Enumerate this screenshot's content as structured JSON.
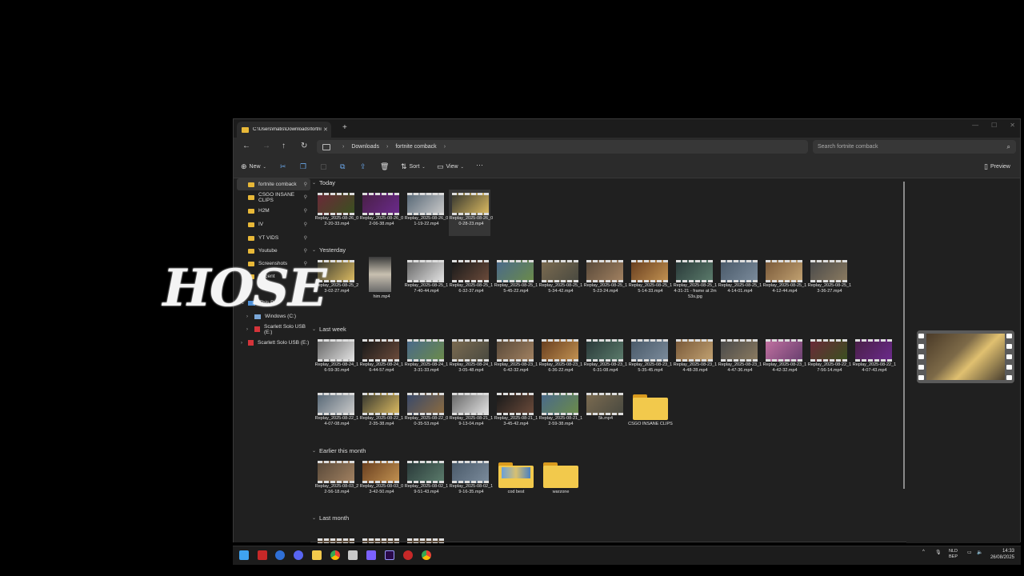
{
  "logo": {
    "text": "HOSE"
  },
  "tab": {
    "title": "C:\\Users\\matis\\Downloads\\fortnite comback",
    "close": "✕",
    "new": "+"
  },
  "window_controls": [
    "—",
    "☐",
    "✕"
  ],
  "breadcrumb": [
    "Downloads",
    "fortnite comback"
  ],
  "search": {
    "placeholder": "Search fortnite comback"
  },
  "commands": {
    "new": "New",
    "sort": "Sort",
    "view": "View",
    "more": "···",
    "preview": "Preview"
  },
  "sidebar": {
    "quick": [
      "fortnite comback",
      "CSGO INSANE CLIPS",
      "H2M",
      "IV",
      "YT VIDS",
      "Youtube",
      "Screenshots",
      "Recent"
    ],
    "this_pc": "This PC",
    "drives": [
      "Windows (C:)",
      "Scarlett Solo USB (E:)",
      "Scarlett Solo USB (E:)"
    ]
  },
  "groups": {
    "today": {
      "label": "Today",
      "files": [
        "Replay_2025-08-26_02-20-33.mp4",
        "Replay_2025-08-26_02-06-38.mp4",
        "Replay_2025-08-26_01-19-22.mp4",
        "Replay_2025-08-26_00-28-23.mp4"
      ]
    },
    "yesterday": {
      "label": "Yesterday",
      "files": [
        "Replay_2025-08-25_23-02-27.mp4",
        "him.mp4",
        "Replay_2025-08-25_17-40-44.mp4",
        "Replay_2025-08-25_16-32-37.mp4",
        "Replay_2025-08-25_15-45-22.mp4",
        "Replay_2025-08-25_15-34-42.mp4",
        "Replay_2025-08-25_15-23-24.mp4",
        "Replay_2025-08-25_15-14-33.mp4",
        "Replay_2025-08-25_14-31-21 - frame at 2m53s.jpg",
        "Replay_2025-08-25_14-14-01.mp4",
        "Replay_2025-08-25_14-12-44.mp4",
        "Replay_2025-08-25_13-36-27.mp4"
      ]
    },
    "last_week": {
      "label": "Last week",
      "files": [
        "Replay_2025-08-24_16-59-30.mp4",
        "Replay_2025-08-24_16-44-57.mp4",
        "Replay_2025-08-24_13-31-33.mp4",
        "Replay_2025-08-24_13-05-48.mp4",
        "Replay_2025-08-23_16-42-32.mp4",
        "Replay_2025-08-23_16-36-22.mp4",
        "Replay_2025-08-23_16-31-08.mp4",
        "Replay_2025-08-23_15-35-45.mp4",
        "Replay_2025-08-23_14-48-28.mp4",
        "Replay_2025-08-23_14-47-36.mp4",
        "Replay_2025-08-23_14-42-32.mp4",
        "Replay_2025-08-22_17-56-14.mp4",
        "Replay_2025-08-22_14-07-43.mp4",
        "Replay_2025-08-22_14-07-08.mp4",
        "Replay_2025-08-22_12-35-38.mp4",
        "Replay_2025-08-22_00-35-53.mp4",
        "Replay_2025-08-21_19-13-04.mp4",
        "Replay_2025-08-21_13-45-42.mp4",
        "Replay_2025-08-21_12-59-38.mp4",
        "5k.mp4",
        "CSGO INSANE CLIPS"
      ]
    },
    "earlier": {
      "label": "Earlier this month",
      "files": [
        "Replay_2025-08-03_22-56-18.mp4",
        "Replay_2025-08-03_03-42-50.mp4",
        "Replay_2025-08-02_19-51-43.mp4",
        "Replay_2025-08-02_19-16-35.mp4",
        "cod best",
        "warzone"
      ]
    },
    "last_month": {
      "label": "Last month"
    }
  },
  "taskbar": {
    "lang": "NLD",
    "lang2": "BEP",
    "time": "14:33",
    "date": "26/08/2025",
    "chevron": "^"
  }
}
